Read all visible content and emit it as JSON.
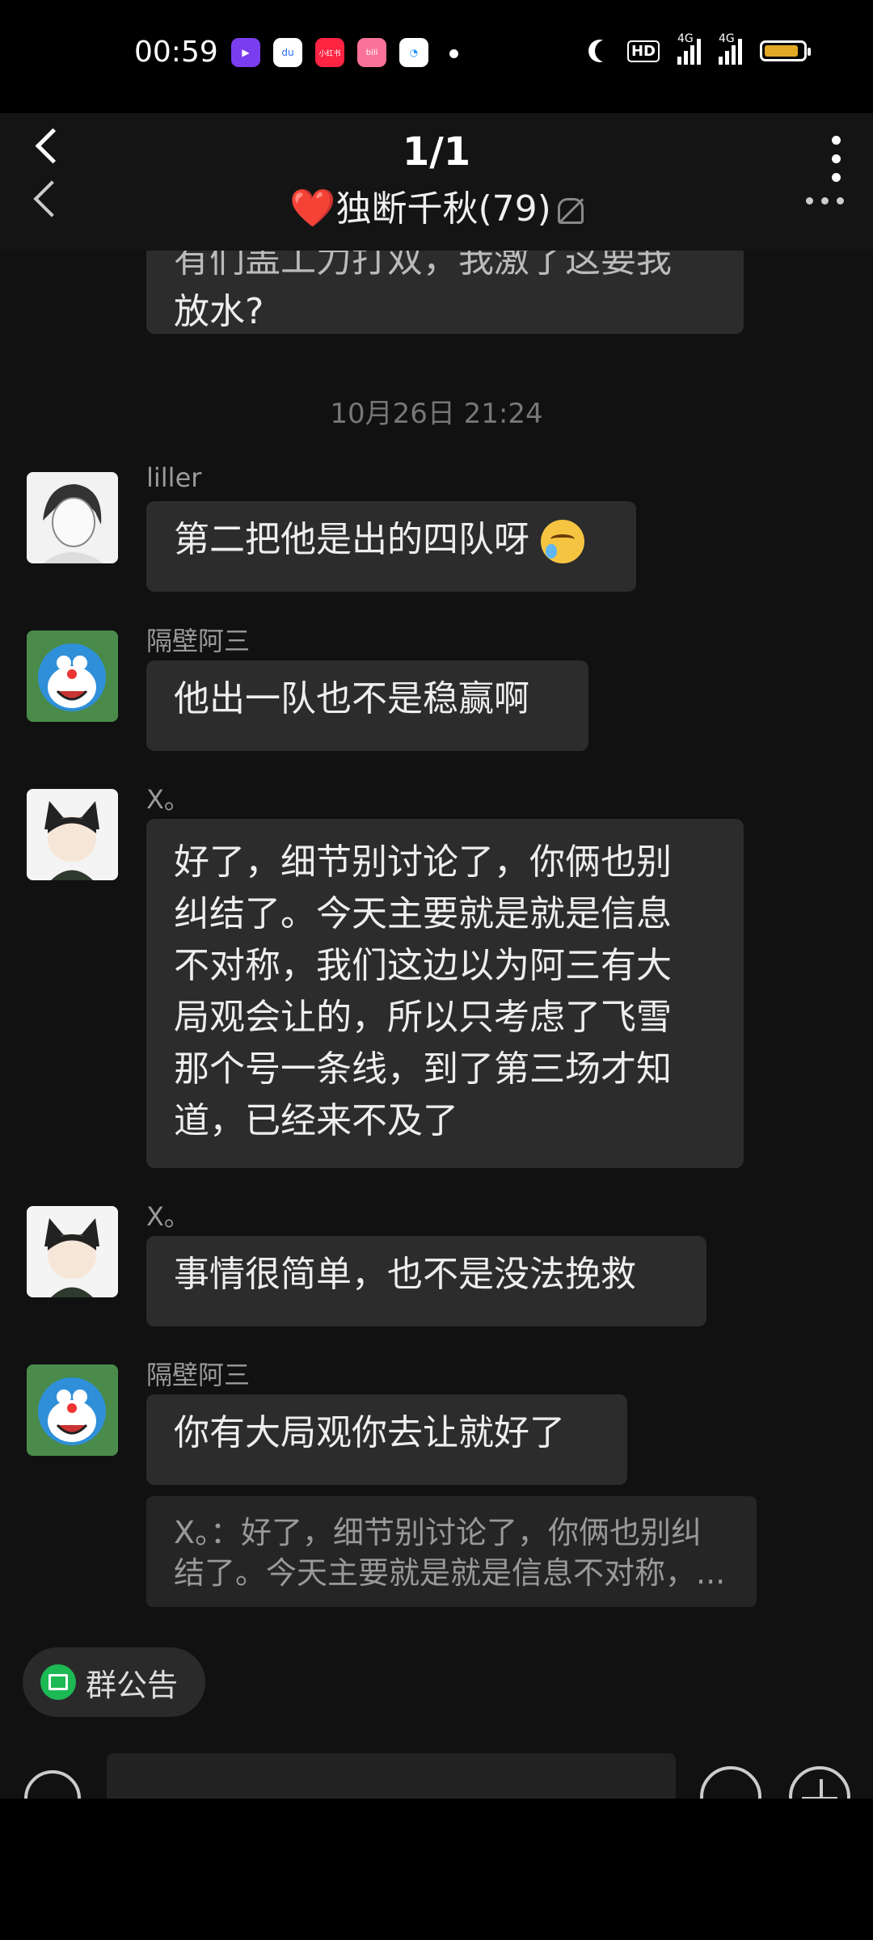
{
  "status_bar": {
    "time": "00:59",
    "network_1": "4G",
    "network_2": "4G",
    "hd_label": "HD",
    "app_icon_labels": [
      "",
      "du",
      "小红书",
      "bili",
      ""
    ]
  },
  "viewer": {
    "page_counter": "1/1"
  },
  "chat_header": {
    "title": "独断千秋",
    "member_count": "(79)",
    "heart": "❤️"
  },
  "messages": [
    {
      "type": "partial",
      "text_line1": "有们盖工力打双，我激了这要我",
      "text_line2": "放水?"
    },
    {
      "type": "timestamp",
      "text": "10月26日 21:24"
    },
    {
      "type": "message",
      "sender": "liller",
      "text": "第二把他是出的四队呀"
    },
    {
      "type": "message",
      "sender": "隔壁阿三",
      "text": "他出一队也不是稳赢啊"
    },
    {
      "type": "message",
      "sender": "X。",
      "lines": [
        "好了，细节别讨论了，你俩也别",
        "纠结了。今天主要就是就是信息",
        "不对称，我们这边以为阿三有大",
        "局观会让的，所以只考虑了飞雪",
        "那个号一条线，到了第三场才知",
        "道，已经来不及了"
      ]
    },
    {
      "type": "message",
      "sender": "X。",
      "text": "事情很简单，也不是没法挽救"
    },
    {
      "type": "message",
      "sender": "隔壁阿三",
      "text": "你有大局观你去让就好了",
      "quote_line1": "X。：好了，细节别讨论了，你俩也别纠",
      "quote_line2": "结了。今天主要就是就是信息不对称，..."
    }
  ],
  "bottom": {
    "announcement_label": "群公告"
  },
  "colors": {
    "bubble": "#2c2c2c",
    "background": "#111111",
    "accent_green": "#1db954"
  }
}
